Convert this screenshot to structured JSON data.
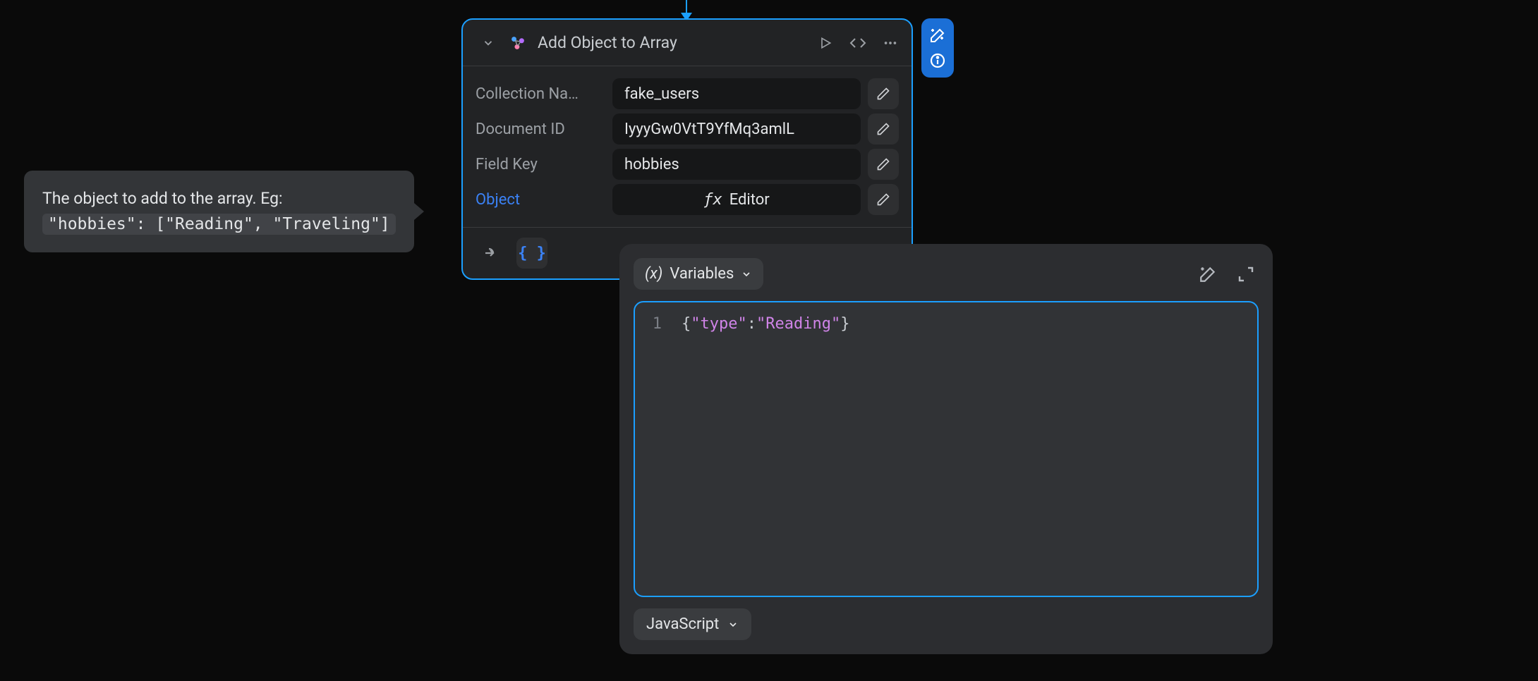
{
  "node": {
    "title": "Add Object to Array",
    "fields": {
      "collection": {
        "label": "Collection Na…",
        "value": "fake_users"
      },
      "document": {
        "label": "Document ID",
        "value": "IyyyGw0VtT9YfMq3amlL"
      },
      "fieldkey": {
        "label": "Field Key",
        "value": "hobbies"
      },
      "object": {
        "label": "Object",
        "editor_label": "Editor"
      }
    }
  },
  "tooltip": {
    "text": "The object to add to the array. Eg:",
    "code": "\"hobbies\": [\"Reading\", \"Traveling\"]"
  },
  "editor": {
    "variables_label": "Variables",
    "line_number": "1",
    "code": {
      "open": "{",
      "key": "\"type\"",
      "colon": ":",
      "val": "\"Reading\"",
      "close": "}"
    },
    "language": "JavaScript"
  },
  "icons": {
    "vars_prefix": "(x)",
    "fx": "ƒx"
  }
}
